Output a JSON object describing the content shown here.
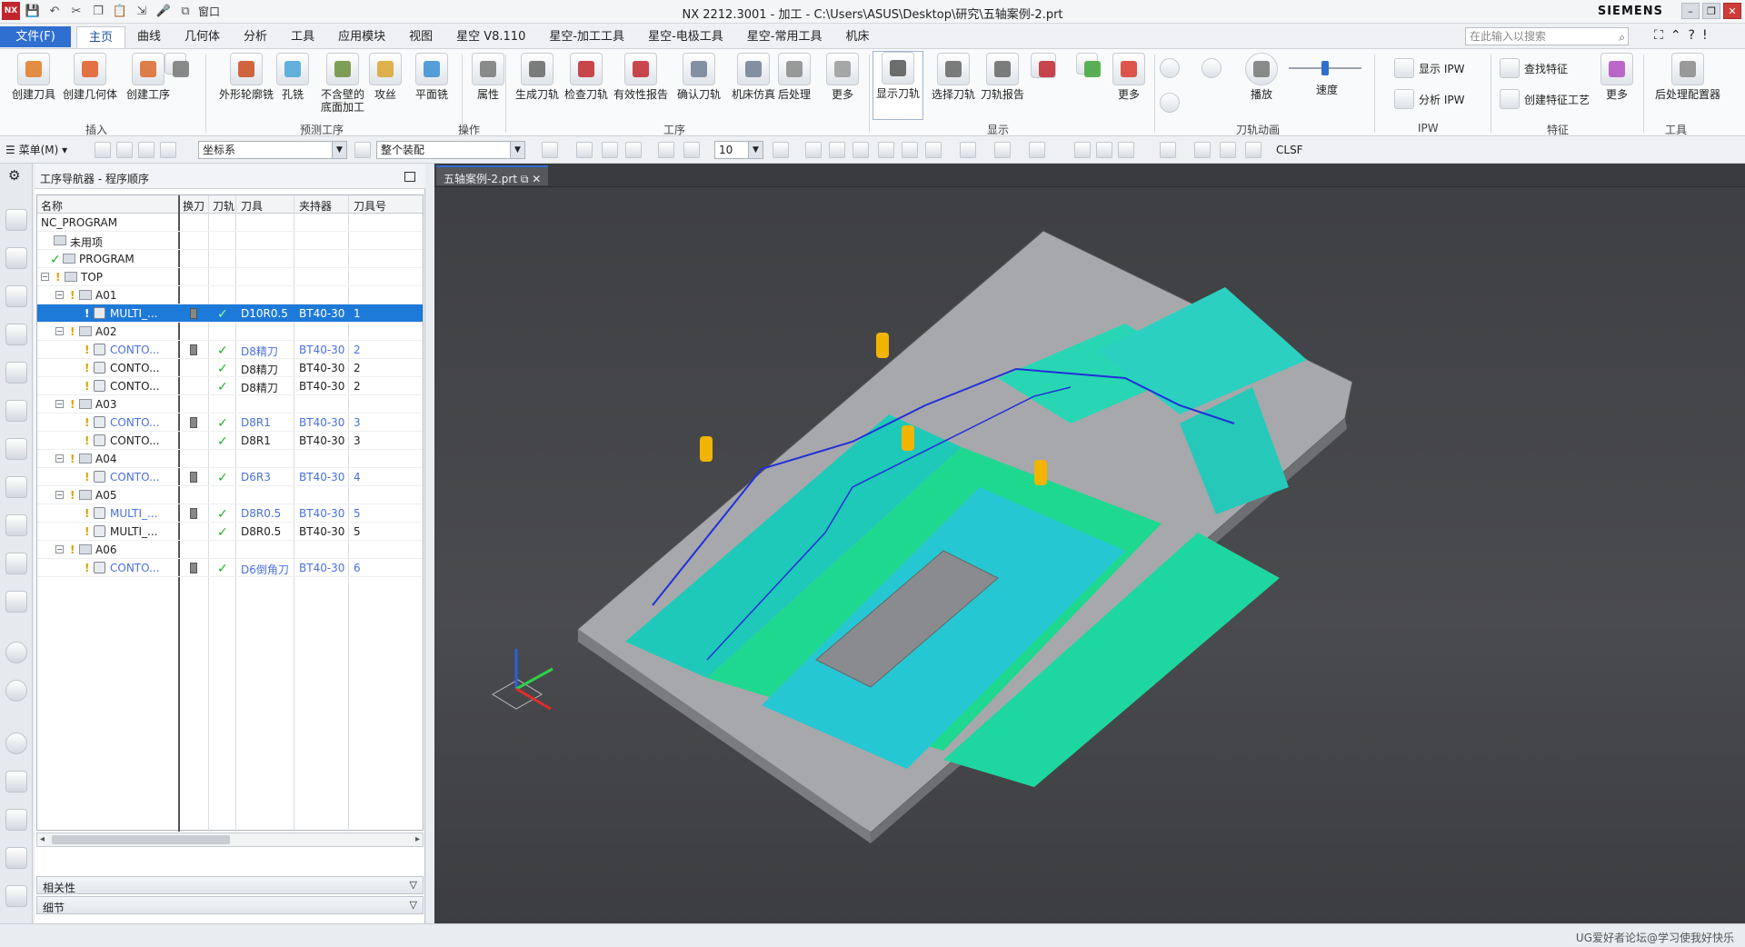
{
  "window": {
    "title": "NX 2212.3001 - 加工 - C:\\Users\\ASUS\\Desktop\\研究\\五轴案例-2.prt",
    "brand": "SIEMENS",
    "quick_access_window": "窗口"
  },
  "menu_tabs": {
    "file": "文件(F)",
    "items": [
      "主页",
      "曲线",
      "几何体",
      "分析",
      "工具",
      "应用模块",
      "视图",
      "星空 V8.110",
      "星空-加工工具",
      "星空-电极工具",
      "星空-常用工具",
      "机床"
    ],
    "active": "主页"
  },
  "search": {
    "placeholder": "在此输入以搜索"
  },
  "ribbon": {
    "buttons": [
      "创建刀具",
      "创建几何体",
      "创建工序",
      "外形轮廓铣",
      "孔铣",
      "不含壁的",
      "底面加工",
      "攻丝",
      "平面铣",
      "属性",
      "生成刀轨",
      "检查刀轨",
      "有效性报告",
      "确认刀轨",
      "机床仿真",
      "后处理",
      "更多",
      "显示刀轨",
      "选择刀轨",
      "刀轨报告",
      "更多",
      "播放",
      "速度",
      "更多",
      "后处理配置器"
    ],
    "groups": [
      "插入",
      "预测工序",
      "操作",
      "工序",
      "显示",
      "刀轨动画",
      "IPW",
      "特征",
      "工具"
    ],
    "ipw": [
      "显示 IPW",
      "分析 IPW"
    ],
    "feature": [
      "查找特征",
      "创建特征工艺"
    ]
  },
  "toolbar2": {
    "menu_label": "菜单(M)",
    "coord": "坐标系",
    "assembly": "整个装配",
    "number": "10",
    "clsf": "CLSF"
  },
  "navigator": {
    "title": "工序导航器 - 程序顺序",
    "columns": [
      "名称",
      "换刀",
      "刀轨",
      "刀具",
      "夹持器",
      "刀具号"
    ],
    "rows": [
      {
        "name": "NC_PROGRAM",
        "tool": "",
        "holder": "",
        "num": ""
      },
      {
        "name": "未用项",
        "tool": "",
        "holder": "",
        "num": ""
      },
      {
        "name": "PROGRAM",
        "tool": "",
        "holder": "",
        "num": ""
      },
      {
        "name": "TOP",
        "tool": "",
        "holder": "",
        "num": ""
      },
      {
        "name": "A01",
        "tool": "",
        "holder": "",
        "num": ""
      },
      {
        "name": "MULTI_...",
        "tool": "D10R0.5",
        "holder": "BT40-30",
        "num": "1"
      },
      {
        "name": "A02",
        "tool": "",
        "holder": "",
        "num": ""
      },
      {
        "name": "CONTO...",
        "tool": "D8精刀",
        "holder": "BT40-30",
        "num": "2"
      },
      {
        "name": "CONTO...",
        "tool": "D8精刀",
        "holder": "BT40-30",
        "num": "2"
      },
      {
        "name": "CONTO...",
        "tool": "D8精刀",
        "holder": "BT40-30",
        "num": "2"
      },
      {
        "name": "A03",
        "tool": "",
        "holder": "",
        "num": ""
      },
      {
        "name": "CONTO...",
        "tool": "D8R1",
        "holder": "BT40-30",
        "num": "3"
      },
      {
        "name": "CONTO...",
        "tool": "D8R1",
        "holder": "BT40-30",
        "num": "3"
      },
      {
        "name": "A04",
        "tool": "",
        "holder": "",
        "num": ""
      },
      {
        "name": "CONTO...",
        "tool": "D6R3",
        "holder": "BT40-30",
        "num": "4"
      },
      {
        "name": "A05",
        "tool": "",
        "holder": "",
        "num": ""
      },
      {
        "name": "MULTI_...",
        "tool": "D8R0.5",
        "holder": "BT40-30",
        "num": "5"
      },
      {
        "name": "MULTI_...",
        "tool": "D8R0.5",
        "holder": "BT40-30",
        "num": "5"
      },
      {
        "name": "A06",
        "tool": "",
        "holder": "",
        "num": ""
      },
      {
        "name": "CONTO...",
        "tool": "D6倒角刀",
        "holder": "BT40-30",
        "num": "6"
      }
    ],
    "panels": [
      "相关性",
      "细节"
    ]
  },
  "viewport": {
    "tab": "五轴案例-2.prt",
    "watermark": "UG爱好者论坛@学习使我好快乐"
  }
}
